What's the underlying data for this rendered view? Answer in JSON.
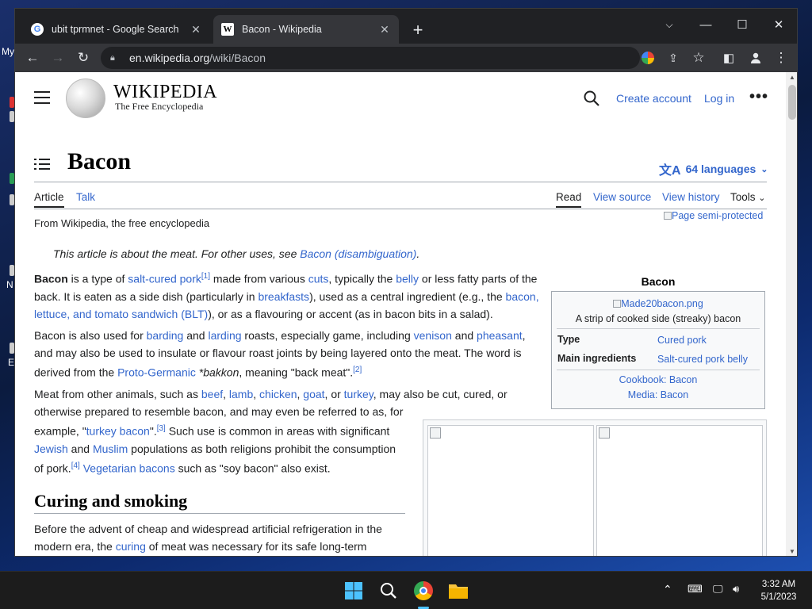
{
  "desktop": {
    "labels": [
      "My",
      "N",
      "E"
    ]
  },
  "browser": {
    "tabs": [
      {
        "title": "ubit tprmnet - Google Search",
        "favicon": "google-icon",
        "active": false
      },
      {
        "title": "Bacon - Wikipedia",
        "favicon": "wikipedia-icon",
        "active": true
      }
    ],
    "url_host": "en.wikipedia.org",
    "url_path": "/wiki/Bacon"
  },
  "wiki": {
    "wordmark": "WIKIPEDIA",
    "tagline": "The Free Encyclopedia",
    "header_links": {
      "create_account": "Create account",
      "login": "Log in"
    },
    "title": "Bacon",
    "languages": "64 languages",
    "page_tabs": {
      "article": "Article",
      "talk": "Talk",
      "read": "Read",
      "view_source": "View source",
      "view_history": "View history",
      "tools": "Tools"
    },
    "from": "From Wikipedia, the free encyclopedia",
    "semi_protected": "Page semi-protected",
    "hatnote_text": "This article is about the meat. For other uses, see ",
    "hatnote_link": "Bacon (disambiguation)",
    "section_heading": "Curing and smoking",
    "infobox": {
      "title": "Bacon",
      "image_alt": "Made20bacon.png",
      "caption": "A strip of cooked side (streaky) bacon",
      "rows": [
        {
          "label": "Type",
          "value": "Cured pork"
        },
        {
          "label": "Main ingredients",
          "value": "Salt-cured pork belly"
        }
      ],
      "cookbook": "Cookbook: Bacon",
      "media": "Media: Bacon"
    }
  },
  "taskbar": {
    "time": "3:32 AM",
    "date": "5/1/2023"
  }
}
